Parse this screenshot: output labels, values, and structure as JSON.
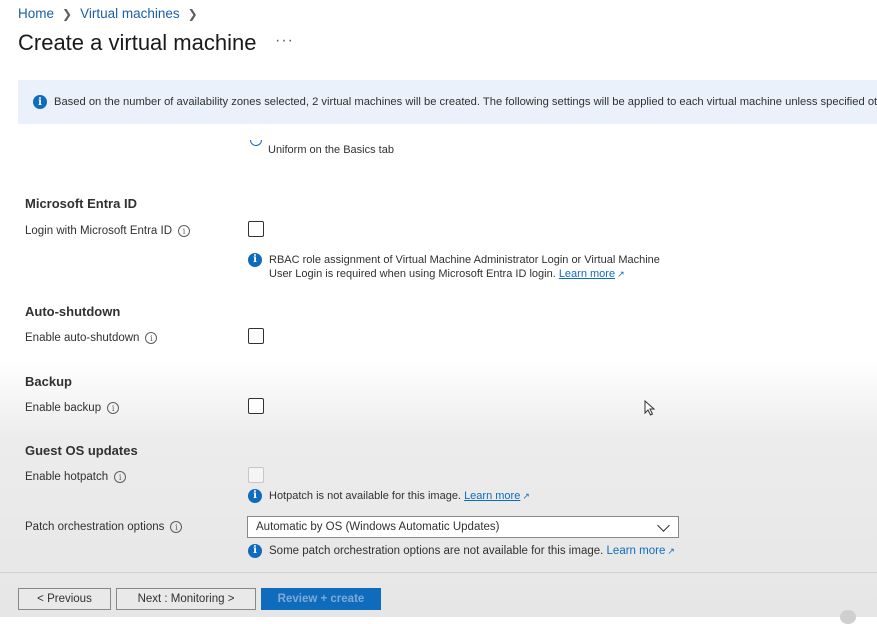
{
  "breadcrumb": {
    "home": "Home",
    "virtual_machines": "Virtual machines",
    "separator": ">"
  },
  "page": {
    "title": "Create a virtual machine",
    "more": "···"
  },
  "banner": {
    "text": "Based on the number of availability zones selected, 2 virtual machines will be created. The following settings will be applied to each virtual machine unless specified otherwise."
  },
  "truncated_option": {
    "text": "Uniform on the Basics tab"
  },
  "entra": {
    "heading": "Microsoft Entra ID",
    "login_label": "Login with Microsoft Entra ID",
    "login_checked": false,
    "note_line1": "RBAC role assignment of Virtual Machine Administrator Login or Virtual Machine",
    "note_line2": "User Login is required when using Microsoft Entra ID login.",
    "learn_more": "Learn more"
  },
  "autoshutdown": {
    "heading": "Auto-shutdown",
    "label": "Enable auto-shutdown",
    "checked": false
  },
  "backup": {
    "heading": "Backup",
    "label": "Enable backup",
    "checked": false
  },
  "guest_os": {
    "heading": "Guest OS updates",
    "hotpatch_label": "Enable hotpatch",
    "hotpatch_note": "Hotpatch is not available for this image.",
    "hotpatch_learn_more": "Learn more",
    "patch_label": "Patch orchestration options",
    "patch_value": "Automatic by OS (Windows Automatic Updates)",
    "patch_note": "Some patch orchestration options are not available for this image.",
    "patch_learn_more": "Learn more"
  },
  "footer": {
    "previous": "< Previous",
    "next": "Next : Monitoring >",
    "review": "Review + create"
  },
  "colors": {
    "accent": "#0f6cbd",
    "banner_bg": "#eaf1fb",
    "text": "#323130"
  },
  "icons": [
    "chevron-right-icon",
    "more-icon",
    "info-icon",
    "tooltip-icon",
    "external-link-icon",
    "chevron-down-icon",
    "mouse-cursor-icon"
  ]
}
